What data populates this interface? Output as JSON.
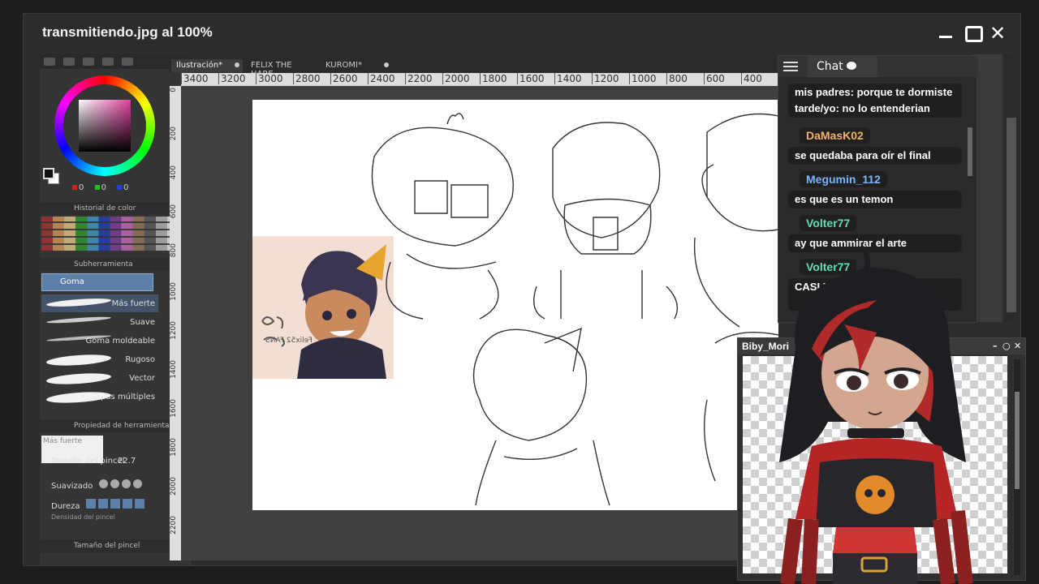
{
  "window": {
    "title": "transmitiendo.jpg al 100%",
    "min_icon": "minimize-icon",
    "max_icon": "maximize-icon",
    "close_glyph": "✕"
  },
  "left_panel": {
    "rgb": [
      "0",
      "0",
      "0"
    ],
    "color_history_title": "Historial de color",
    "subtool_title": "Subherramienta",
    "selected_subtool": "Goma",
    "brushes": [
      "Más fuerte",
      "Suave",
      "Goma moldeable",
      "Rugoso",
      "Vector",
      "Capas múltiples"
    ],
    "tool_property_title": "Propiedad de herramienta",
    "preview_label": "Más fuerte",
    "brush_size_label": "Tamaño del pincel",
    "brush_size_value": "22.7",
    "smoothing_label": "Suavizado",
    "hardness_label": "Dureza",
    "brush_density_label": "Densidad del pincel",
    "brush_size_panel_title": "Tamaño del pincel"
  },
  "canvas": {
    "tabs": [
      "Ilustración*",
      "FELIX THE HARE",
      "KUROMI*"
    ],
    "ruler_h": [
      "3400",
      "3200",
      "3000",
      "2800",
      "2600",
      "2400",
      "2200",
      "2000",
      "1800",
      "1600",
      "1400",
      "1200",
      "1000",
      "800",
      "600",
      "400"
    ],
    "ruler_v": [
      "0",
      "200",
      "400",
      "600",
      "800",
      "1000",
      "1200",
      "1400",
      "1600",
      "1800",
      "2000",
      "2200"
    ],
    "reference_signature": "Felix52 FANS"
  },
  "chat": {
    "tab_title": "Chat",
    "messages": [
      {
        "user": "",
        "text": "mis padres: porque te dormiste tarde/yo: no lo entenderian"
      },
      {
        "user": "DaMasK02",
        "color": "#f0b36b",
        "text": "se quedaba para oír el final"
      },
      {
        "user": "Megumin_112",
        "color": "#7cb4ff",
        "text": "es que es un temon"
      },
      {
        "user": "Volter77",
        "color": "#5fe0b0",
        "text": "ay que ammirar el arte"
      },
      {
        "user": "Volter77",
        "color": "#5fe0b0",
        "text": "CASI ME ... CO MI TOR..."
      }
    ]
  },
  "avatar_window": {
    "title": "Biby_Mori",
    "controls": [
      "–",
      "○",
      "✕"
    ]
  }
}
